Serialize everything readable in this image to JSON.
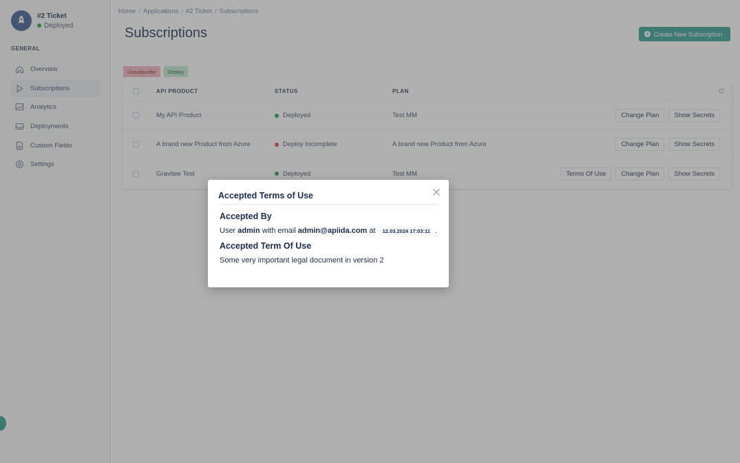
{
  "app": {
    "name": "#2 Ticket",
    "status": "Deployed"
  },
  "sidebar": {
    "section_label": "GENERAL",
    "items": [
      {
        "label": "Overview",
        "icon": "home-icon"
      },
      {
        "label": "Subscriptions",
        "icon": "play-icon",
        "active": true
      },
      {
        "label": "Analytics",
        "icon": "chart-icon"
      },
      {
        "label": "Deployments",
        "icon": "inbox-icon"
      },
      {
        "label": "Custom Fields",
        "icon": "document-icon"
      },
      {
        "label": "Settings",
        "icon": "gear-icon"
      }
    ]
  },
  "breadcrumb": [
    "Home",
    "Applications",
    "#2 Ticket",
    "Subscriptions"
  ],
  "page_title": "Subscriptions",
  "create_button": "Create New Subscription",
  "bulk_actions": {
    "unsubscribe": "Unsubscribe",
    "deploy": "Deploy"
  },
  "table": {
    "headers": {
      "product": "API PRODUCT",
      "status": "STATUS",
      "plan": "PLAN"
    },
    "rows": [
      {
        "product": "My API Product",
        "status": "Deployed",
        "status_color": "#1e9e4a",
        "plan": "Test MM",
        "actions": [
          "Change Plan",
          "Show Secrets"
        ]
      },
      {
        "product": "A brand new Product from Azure",
        "status": "Deploy Incomplete",
        "status_color": "#d64545",
        "plan": "A brand new Product from Azure",
        "actions": [
          "Change Plan",
          "Show Secrets"
        ]
      },
      {
        "product": "Gravitee Test",
        "status": "Deployed",
        "status_color": "#1e9e4a",
        "plan": "Test MM",
        "actions": [
          "Terms Of Use",
          "Change Plan",
          "Show Secrets"
        ]
      }
    ]
  },
  "modal": {
    "title": "Accepted Terms of Use",
    "accepted_by_heading": "Accepted By",
    "line": {
      "user_prefix": "User",
      "user": "admin",
      "with_email": "with email",
      "email": "admin@apiida.com",
      "at": "at",
      "timestamp": "12.03.2024 17:03:11",
      "end": "."
    },
    "term_heading": "Accepted Term Of Use",
    "document": "Some very important legal document in version 2"
  },
  "colors": {
    "accent": "#2f9e8f",
    "brand": "#3b5a8c"
  }
}
